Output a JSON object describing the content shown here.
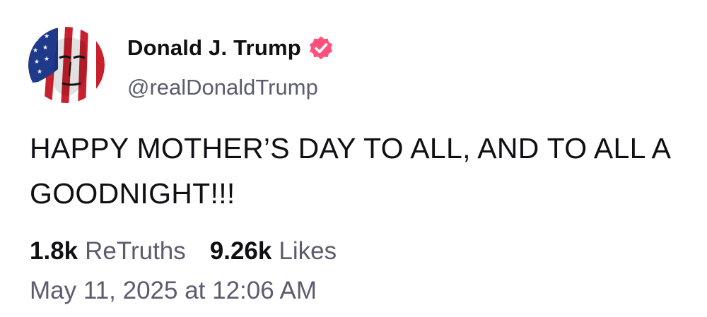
{
  "author": {
    "display_name": "Donald J. Trump",
    "handle": "@realDonaldTrump",
    "avatar_icon": "flag-portrait-avatar",
    "verified_icon": "verified-badge-icon",
    "verified_color": "#ff4f7a"
  },
  "post": {
    "text": "HAPPY MOTHER’S DAY TO ALL, AND TO ALL A GOODNIGHT!!!"
  },
  "stats": {
    "retruths_count": "1.8k",
    "retruths_label": "ReTruths",
    "likes_count": "9.26k",
    "likes_label": "Likes"
  },
  "timestamp": "May 11, 2025 at 12:06 AM"
}
